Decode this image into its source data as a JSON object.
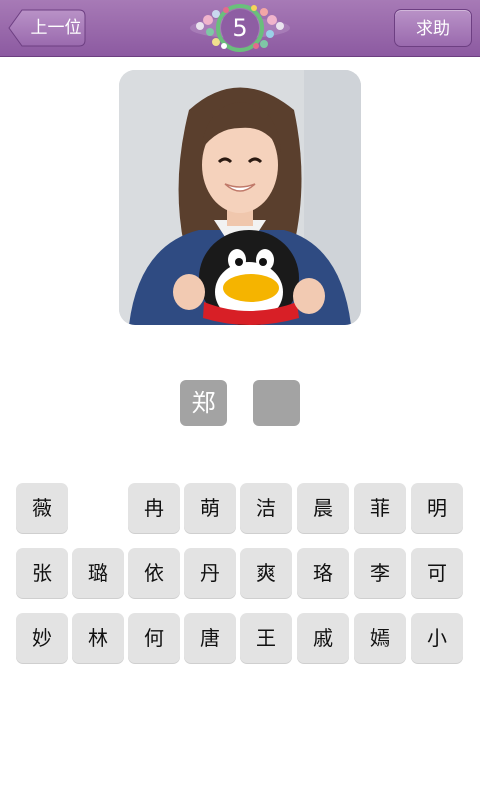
{
  "header": {
    "back_label": "上一位",
    "help_label": "求助",
    "level": "5"
  },
  "answer": {
    "slots": [
      "郑",
      ""
    ]
  },
  "keyboard": {
    "row1": [
      "薇",
      "",
      "冉",
      "萌",
      "洁",
      "晨",
      "菲",
      "明"
    ],
    "row2": [
      "张",
      "璐",
      "依",
      "丹",
      "爽",
      "珞",
      "李",
      "可"
    ],
    "row3": [
      "妙",
      "林",
      "何",
      "唐",
      "王",
      "戚",
      "嫣",
      "小"
    ]
  },
  "colors": {
    "header": "#9a6aae",
    "slot": "#a3a3a3",
    "key": "#e3e3e3"
  }
}
